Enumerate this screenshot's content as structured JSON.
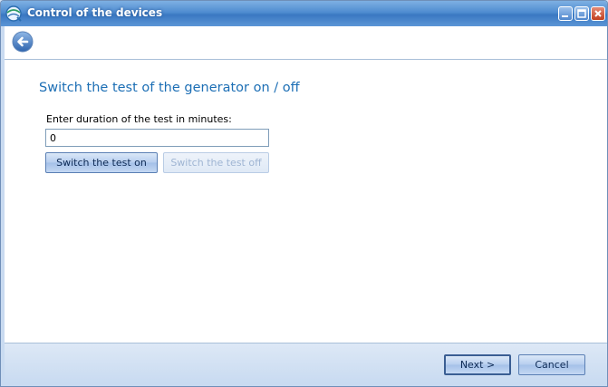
{
  "window": {
    "title": "Control of the devices",
    "icon": "app-globe-icon",
    "controls": [
      "minimize-icon",
      "maximize-icon",
      "close-icon"
    ]
  },
  "nav": {
    "back_icon": "back-arrow-icon"
  },
  "main": {
    "heading": "Switch the test of the generator on / off",
    "duration_label": "Enter duration of the test in minutes:",
    "duration_value": "0",
    "switch_on_label": "Switch the test on",
    "switch_off_label": "Switch the test off",
    "switch_off_enabled": false
  },
  "footer": {
    "next_label": "Next >",
    "cancel_label": "Cancel"
  },
  "colors": {
    "titlebar": "#4f8cd0",
    "heading": "#1d6fb5",
    "accent": "#3a78c2"
  }
}
